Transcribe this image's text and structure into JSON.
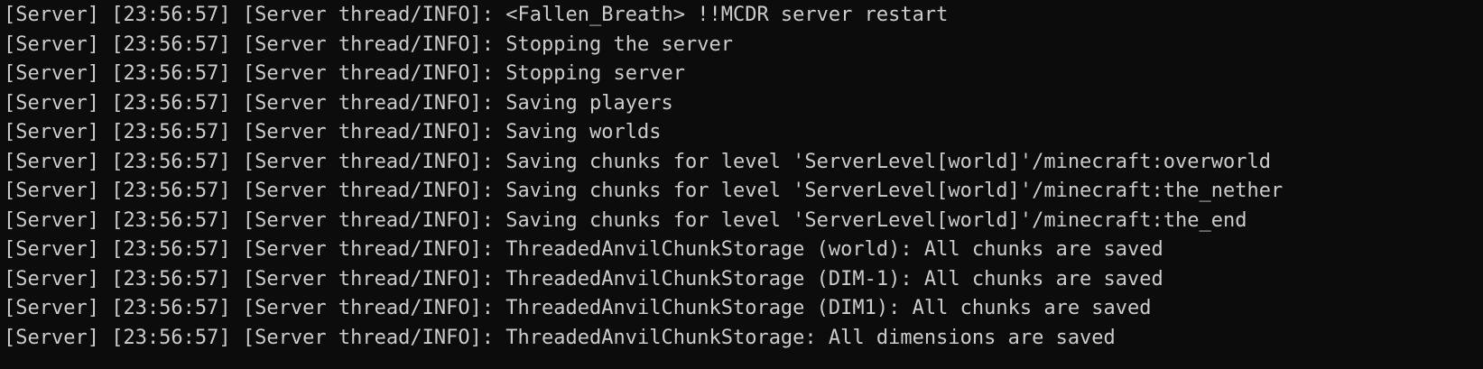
{
  "terminal": {
    "background": "#0c0c0c",
    "foreground": "#cccccc",
    "lines": [
      "[Server] [23:56:57] [Server thread/INFO]: <Fallen_Breath> !!MCDR server restart",
      "[Server] [23:56:57] [Server thread/INFO]: Stopping the server",
      "[Server] [23:56:57] [Server thread/INFO]: Stopping server",
      "[Server] [23:56:57] [Server thread/INFO]: Saving players",
      "[Server] [23:56:57] [Server thread/INFO]: Saving worlds",
      "[Server] [23:56:57] [Server thread/INFO]: Saving chunks for level 'ServerLevel[world]'/minecraft:overworld",
      "[Server] [23:56:57] [Server thread/INFO]: Saving chunks for level 'ServerLevel[world]'/minecraft:the_nether",
      "[Server] [23:56:57] [Server thread/INFO]: Saving chunks for level 'ServerLevel[world]'/minecraft:the_end",
      "[Server] [23:56:57] [Server thread/INFO]: ThreadedAnvilChunkStorage (world): All chunks are saved",
      "[Server] [23:56:57] [Server thread/INFO]: ThreadedAnvilChunkStorage (DIM-1): All chunks are saved",
      "[Server] [23:56:57] [Server thread/INFO]: ThreadedAnvilChunkStorage (DIM1): All chunks are saved",
      "[Server] [23:56:57] [Server thread/INFO]: ThreadedAnvilChunkStorage: All dimensions are saved"
    ]
  }
}
